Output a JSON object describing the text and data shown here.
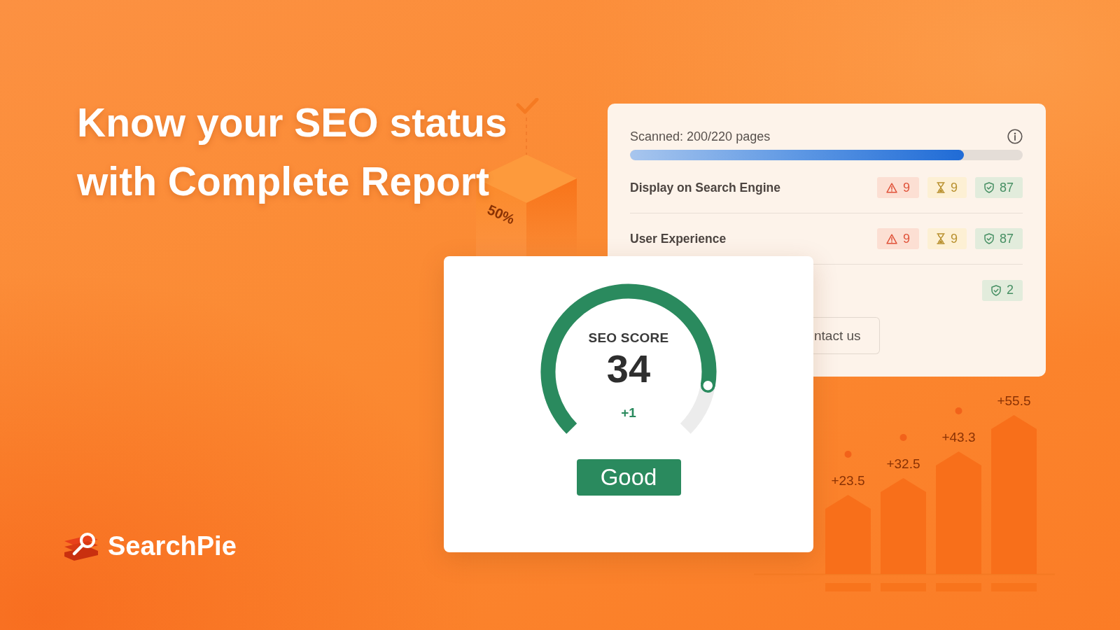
{
  "headline": [
    "Know your SEO status",
    "with Complete Report"
  ],
  "cube": {
    "label": "50%"
  },
  "scan_card": {
    "title": "Scanned: 200/220 pages",
    "progress": {
      "level": 0.85
    },
    "rows": [
      {
        "label": "Display on Search Engine",
        "counts": [
          {
            "kind": "error",
            "value": "9"
          },
          {
            "kind": "warning",
            "value": "9"
          },
          {
            "kind": "passed",
            "value": "87"
          }
        ]
      },
      {
        "label": "User Experience",
        "counts": [
          {
            "kind": "error",
            "value": "9"
          },
          {
            "kind": "warning",
            "value": "9"
          },
          {
            "kind": "passed",
            "value": "87"
          }
        ]
      },
      {
        "counts": [
          {
            "kind": "passed",
            "value": "2"
          }
        ]
      }
    ],
    "button": "ntact us"
  },
  "score_card": {
    "title": "SEO SCORE",
    "score": "34",
    "change": "+1",
    "gauge": {
      "level": 0.87
    },
    "rating": "Good"
  },
  "bar_illustration": {
    "bar_labels": [
      "+23.5",
      "+32.5",
      "+43.3",
      "+55.5"
    ]
  },
  "logo": {
    "name": "SearchPie"
  }
}
